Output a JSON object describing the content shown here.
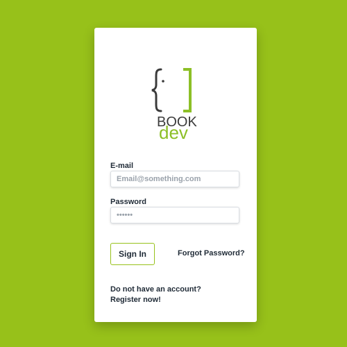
{
  "logo": {
    "word_top": "BOOK",
    "word_bottom": "dev",
    "accent_color": "#8cbf26",
    "dark_color": "#3b3b3b"
  },
  "form": {
    "email_label": "E-mail",
    "email_placeholder": "Email@something.com",
    "password_label": "Password",
    "password_placeholder": "••••••",
    "signin_label": "Sign In",
    "forgot_label": "Forgot Password?",
    "no_account_text": "Do not have an account?",
    "register_label": "Register now!"
  },
  "colors": {
    "background": "#97c11a",
    "card": "#ffffff",
    "text": "#1f2a36"
  }
}
